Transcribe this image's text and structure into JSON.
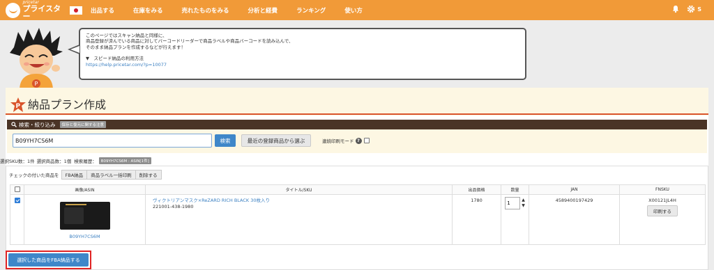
{
  "nav": {
    "logo_small": "pricetar",
    "logo_big": "プライスター",
    "links": [
      "出品する",
      "在庫をみる",
      "売れたものをみる",
      "分析と経費",
      "ランキング",
      "使い方"
    ],
    "user_initial": "S"
  },
  "bubble": {
    "line1": "このページではスキャン納品と同様に、",
    "line2": "商品登録が済んでいる商品に対してバーコードリーダーで商品ラベルや商品バーコードを読み込んで、",
    "line3": "そのまま納品プランを作成するなどが行えます！",
    "link_label": "▼　スピード納品の利用方法",
    "link_url": "https://help.pricetar.com/?p=10077"
  },
  "page": {
    "badge_letter": "P",
    "title": "納品プラン作成"
  },
  "search": {
    "section_label": "検索・絞り込み",
    "warning_badge": "保存と復元に関する注意",
    "input_value": "B09YH7CS6M",
    "search_button": "検索",
    "recent_button": "最近の登録商品から選ぶ",
    "serial_print_label": "連続印刷モード"
  },
  "stats": {
    "selected_sku": "選択SKU数：1件",
    "selected_count": "選択商品数：1個",
    "history_label": "検索履歴：",
    "history_badge": "B09YH7CS6M : ASIN[1件]"
  },
  "actions": {
    "checked_label": "チェックの付いた商品を",
    "buttons": [
      "FBA納品",
      "商品ラベル一括印刷",
      "削除する"
    ]
  },
  "table": {
    "headers": [
      "画像/ASIN",
      "タイトル/SKU",
      "出品価格",
      "数量",
      "JAN",
      "FNSKU"
    ],
    "rows": [
      {
        "checked": true,
        "asin": "B09YH7CS6M",
        "title": "ヴィクトリアンマスク×ReZARD RICH BLACK 30枚入り",
        "sku": "221001-438-1980",
        "price": "1780",
        "qty": "1",
        "jan": "4589400197429",
        "fnsku": "X00121JL4H",
        "print_button": "印刷する"
      }
    ]
  },
  "footer": {
    "fba_button": "選択した商品をFBA納品する"
  },
  "colors": {
    "nav_orange": "#f19a38",
    "dark_bar": "#4a3426",
    "accent_blue": "#3f87c9",
    "title_line": "#d9542b",
    "highlight_red": "#e02424"
  }
}
